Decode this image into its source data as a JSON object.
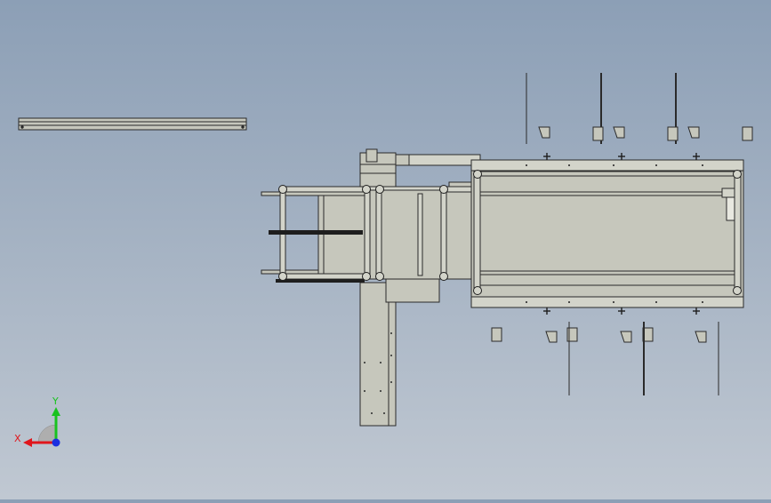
{
  "viewport": {
    "background_top": "#8c9fb6",
    "background_bottom": "#c0c8d2",
    "part_fill": "#c6c7bc",
    "part_fill_light": "#d3d4ca",
    "line_color": "#2a2a2a"
  },
  "triad": {
    "x_label": "X",
    "y_label": "Y",
    "x_color": "#e0161c",
    "y_color": "#19c21f",
    "z_color": "#1a2ee0"
  }
}
